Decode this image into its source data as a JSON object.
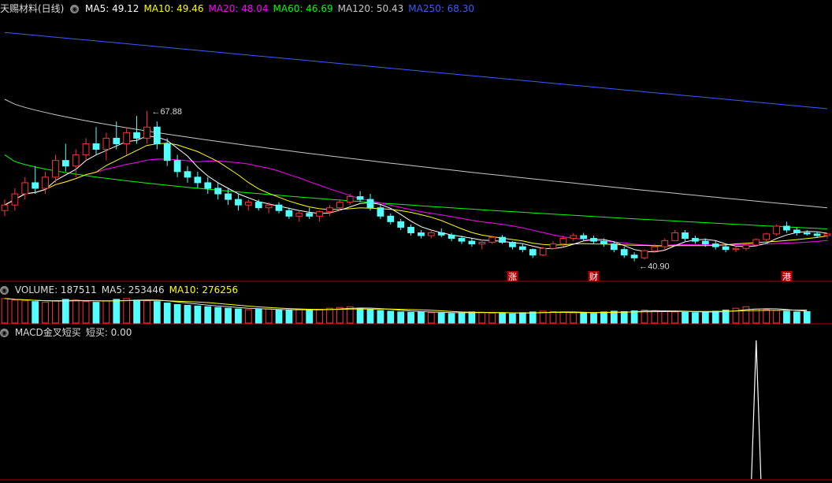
{
  "price_panel": {
    "title": "天赐材料(日线)",
    "ma_labels": [
      {
        "text": "MA5: 49.12",
        "color": "#ffffff"
      },
      {
        "text": "MA10: 49.46",
        "color": "#ffff00"
      },
      {
        "text": "MA20: 48.04",
        "color": "#ff00ff"
      },
      {
        "text": "MA60: 46.69",
        "color": "#00ff00"
      },
      {
        "text": "MA120: 50.43",
        "color": "#c8c8c8"
      },
      {
        "text": "MA250: 68.30",
        "color": "#3a5cff"
      }
    ],
    "high_label": "67.88",
    "low_label": "40.90",
    "markers": [
      "涨",
      "财",
      "港"
    ]
  },
  "volume_panel": {
    "labels": [
      {
        "text": "VOLUME: 187511",
        "color": "#dddddd"
      },
      {
        "text": "MA5: 253446",
        "color": "#dddddd"
      },
      {
        "text": "MA10: 276256",
        "color": "#ffff00"
      }
    ]
  },
  "macd_panel": {
    "labels": [
      {
        "text": "MACD金叉短买",
        "color": "#dddddd"
      },
      {
        "text": "短买: 0.00",
        "color": "#dddddd"
      }
    ]
  },
  "chart_data": {
    "type": "candlestick",
    "ohlc": [
      [
        50,
        52,
        49,
        51
      ],
      [
        51,
        54,
        50,
        53
      ],
      [
        53,
        56,
        52,
        55
      ],
      [
        55,
        58,
        53,
        54
      ],
      [
        54,
        57,
        53,
        56
      ],
      [
        56,
        60,
        55,
        59
      ],
      [
        59,
        62,
        57,
        58
      ],
      [
        58,
        61,
        56,
        60
      ],
      [
        60,
        63,
        59,
        62
      ],
      [
        62,
        65,
        60,
        61
      ],
      [
        61,
        64,
        59,
        63
      ],
      [
        63,
        66,
        61,
        62
      ],
      [
        62,
        65,
        60,
        64
      ],
      [
        64,
        67,
        62,
        63
      ],
      [
        63,
        67.88,
        62,
        65
      ],
      [
        65,
        66,
        61,
        62
      ],
      [
        62,
        63,
        58,
        59
      ],
      [
        59,
        60,
        56,
        57
      ],
      [
        57,
        58,
        55,
        56
      ],
      [
        56,
        57,
        54,
        55
      ],
      [
        55,
        56,
        53,
        54
      ],
      [
        54,
        55,
        52,
        53
      ],
      [
        53,
        54,
        51,
        52
      ],
      [
        52,
        53,
        50,
        51
      ],
      [
        51,
        52,
        50,
        51.5
      ],
      [
        51.5,
        52,
        50,
        50.5
      ],
      [
        50.5,
        51.5,
        49.5,
        51
      ],
      [
        51,
        51.5,
        49.5,
        50
      ],
      [
        50,
        50.5,
        48.5,
        49
      ],
      [
        49,
        50,
        48,
        49.5
      ],
      [
        49.5,
        50.5,
        48.5,
        49
      ],
      [
        49,
        50,
        48,
        49.8
      ],
      [
        49.8,
        51,
        49,
        50.5
      ],
      [
        50.5,
        52,
        50,
        51.5
      ],
      [
        51.5,
        53,
        51,
        52.5
      ],
      [
        52.5,
        53.5,
        51.5,
        52
      ],
      [
        52,
        53,
        50,
        50.5
      ],
      [
        50.5,
        51,
        48.5,
        49
      ],
      [
        49,
        49.5,
        47.5,
        48
      ],
      [
        48,
        48.5,
        46.5,
        47
      ],
      [
        47,
        47.5,
        45.5,
        46
      ],
      [
        46,
        46.5,
        45,
        45.5
      ],
      [
        45.5,
        46.5,
        45,
        46
      ],
      [
        46,
        46.8,
        45.2,
        45.6
      ],
      [
        45.6,
        46,
        44.5,
        45
      ],
      [
        45,
        45.5,
        44,
        44.5
      ],
      [
        44.5,
        45,
        43.5,
        44
      ],
      [
        44,
        44.8,
        43,
        44.3
      ],
      [
        44.3,
        45.5,
        44,
        45.2
      ],
      [
        45.2,
        45.6,
        44,
        44.3
      ],
      [
        44.3,
        44.5,
        43,
        43.5
      ],
      [
        43.5,
        44,
        42.5,
        43
      ],
      [
        43,
        43.2,
        41.5,
        42
      ],
      [
        42,
        43.5,
        41.8,
        43.2
      ],
      [
        43.2,
        44.5,
        43,
        44
      ],
      [
        44,
        45.5,
        43.5,
        45
      ],
      [
        45,
        46,
        44.5,
        45.5
      ],
      [
        45.5,
        46,
        44.5,
        45
      ],
      [
        45,
        45.5,
        44,
        44.5
      ],
      [
        44.5,
        45,
        43.5,
        44
      ],
      [
        44,
        44.5,
        42.5,
        43
      ],
      [
        43,
        43.5,
        41.5,
        42
      ],
      [
        42,
        42.5,
        40.9,
        41.5
      ],
      [
        41.5,
        43,
        41.2,
        42.8
      ],
      [
        42.8,
        44,
        42.5,
        43.5
      ],
      [
        43.5,
        45,
        43,
        44.6
      ],
      [
        44.6,
        46.5,
        44.5,
        46
      ],
      [
        46,
        46.5,
        44.5,
        45
      ],
      [
        45,
        45.5,
        44,
        44.5
      ],
      [
        44.5,
        45,
        43.5,
        44
      ],
      [
        44,
        44.5,
        43,
        43.5
      ],
      [
        43.5,
        44,
        42.5,
        43
      ],
      [
        43,
        43.5,
        42.5,
        43.2
      ],
      [
        43.2,
        44,
        42.8,
        43.8
      ],
      [
        43.8,
        45,
        43.5,
        44.8
      ],
      [
        44.8,
        46,
        44.5,
        45.8
      ],
      [
        45.8,
        47.5,
        45.5,
        47.2
      ],
      [
        47.2,
        48,
        46,
        46.5
      ],
      [
        46.5,
        47,
        45.5,
        46
      ],
      [
        46,
        46.5,
        45.5,
        45.8
      ],
      [
        45.8,
        46.2,
        45.2,
        45.5
      ],
      [
        45.5,
        46,
        45,
        45.8
      ]
    ],
    "volume": [
      330,
      310,
      300,
      290,
      280,
      300,
      320,
      310,
      290,
      280,
      300,
      320,
      330,
      310,
      300,
      290,
      270,
      250,
      240,
      230,
      220,
      210,
      200,
      190,
      180,
      185,
      190,
      175,
      170,
      180,
      175,
      185,
      200,
      210,
      220,
      200,
      180,
      170,
      160,
      150,
      145,
      150,
      140,
      135,
      130,
      140,
      150,
      145,
      135,
      130,
      125,
      140,
      150,
      160,
      155,
      145,
      140,
      135,
      130,
      150,
      160,
      155,
      165,
      175,
      170,
      160,
      150,
      145,
      140,
      150,
      160,
      175,
      200,
      220,
      190,
      180,
      170,
      160,
      150,
      155
    ],
    "macd_signal": {
      "index": 74,
      "value": 1
    }
  }
}
